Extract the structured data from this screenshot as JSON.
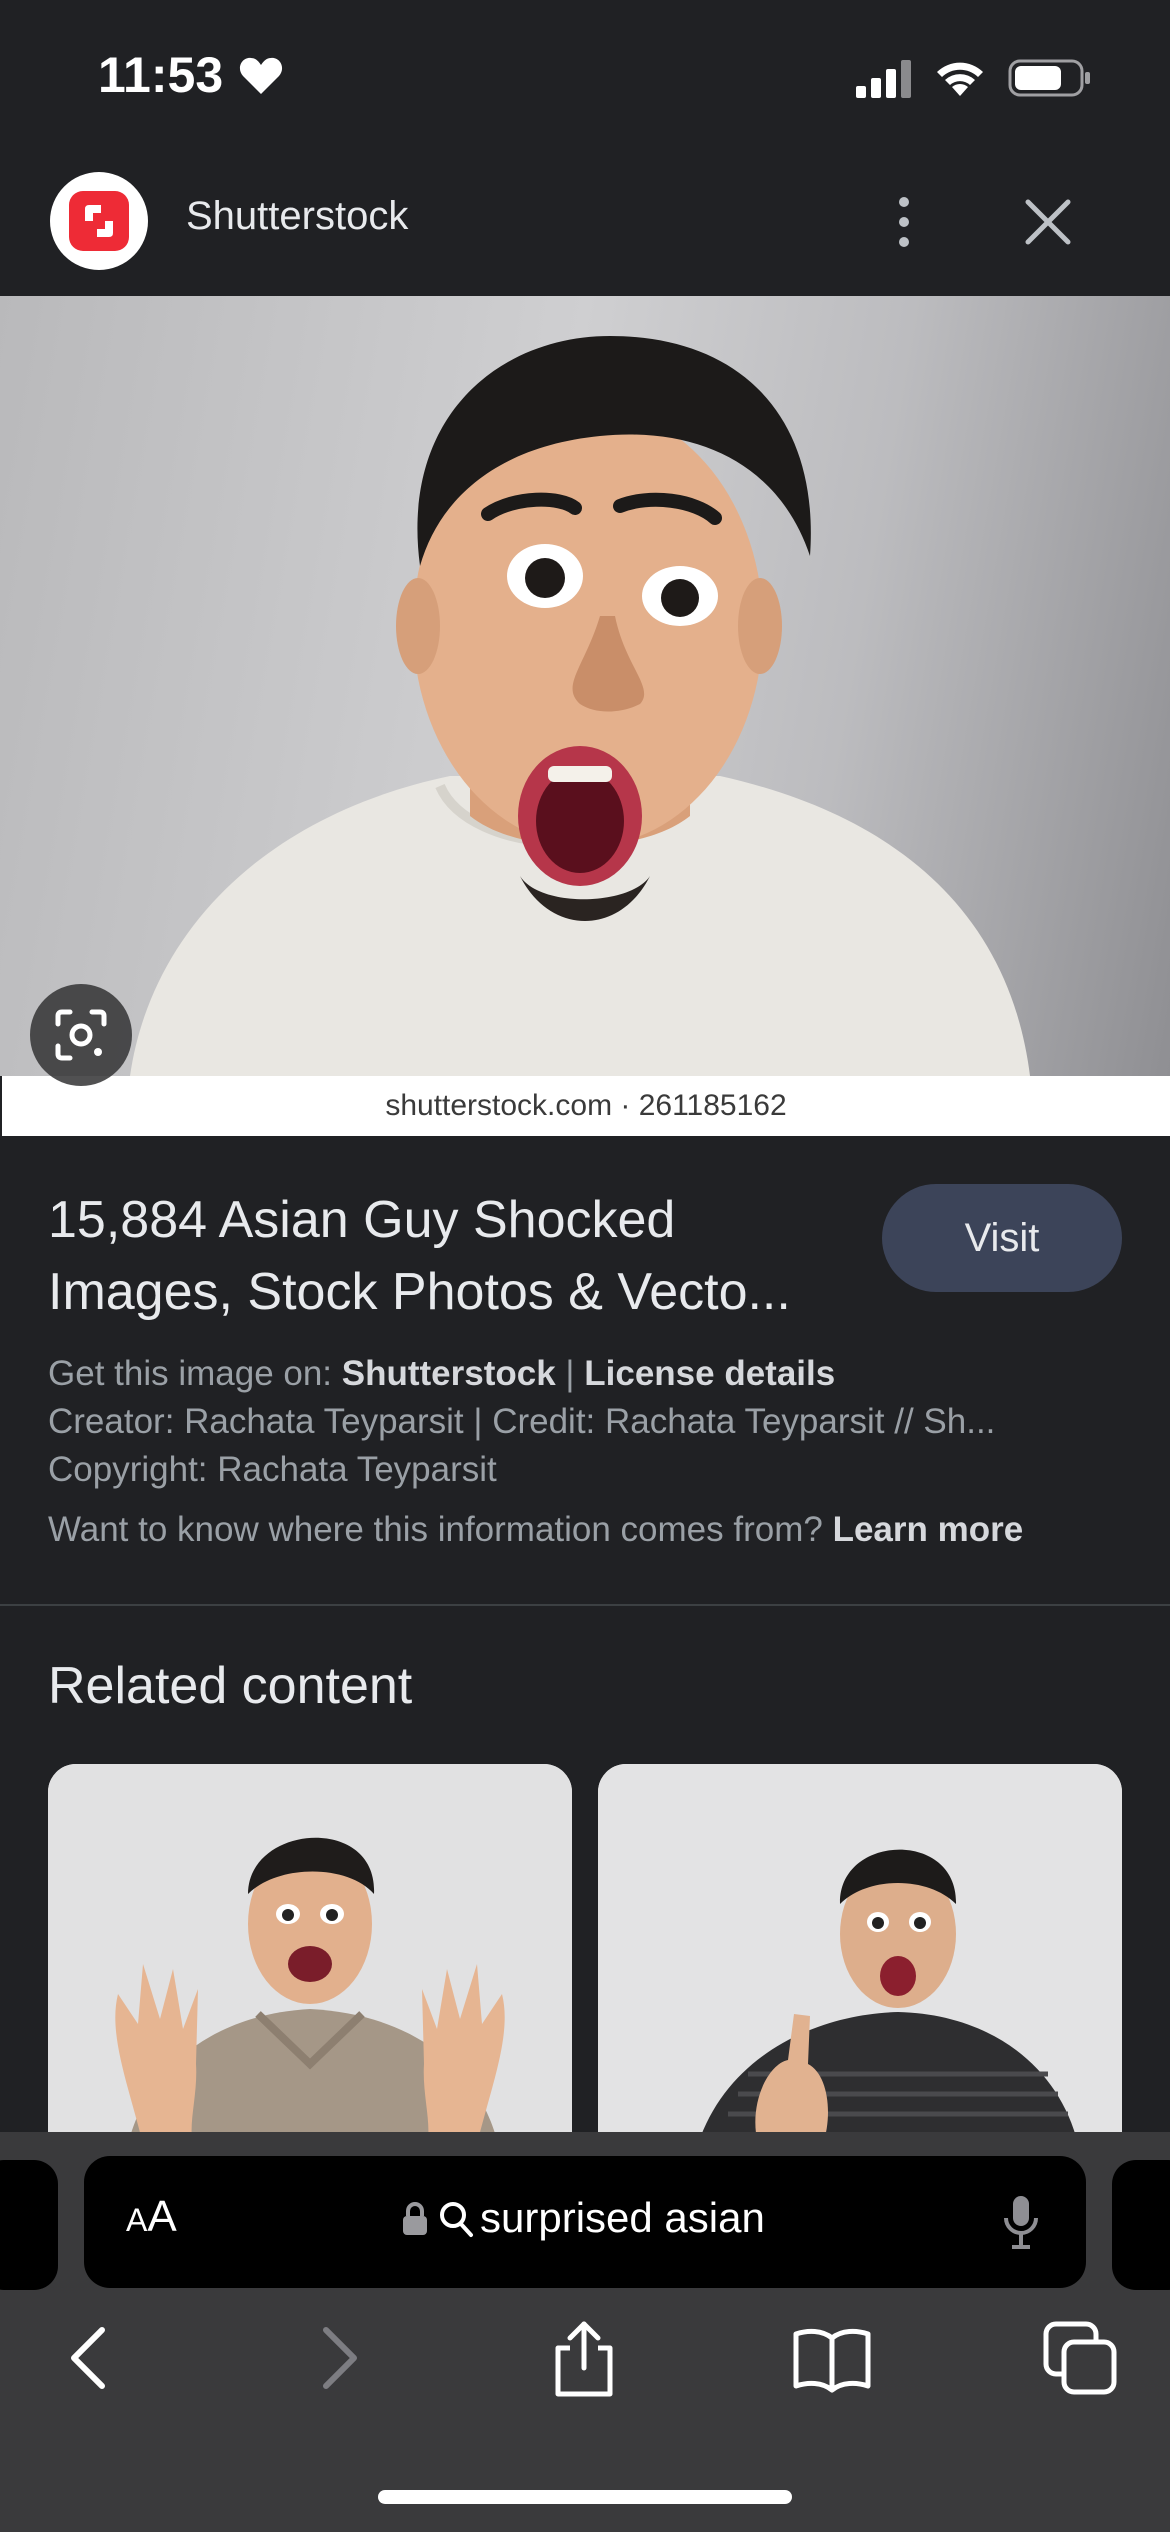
{
  "status_bar": {
    "time": "11:53"
  },
  "header": {
    "site_name": "Shutterstock"
  },
  "image": {
    "watermark_caption": "shutterstock.com · 261185162"
  },
  "info": {
    "title_line1": "15,884 Asian Guy Shocked",
    "title_line2": "Images, Stock Photos & Vecto...",
    "visit_label": "Visit",
    "get_image_prefix": "Get this image on: ",
    "get_image_source": "Shutterstock",
    "separator": " | ",
    "license_link": "License details",
    "creator_line": "Creator: Rachata Teyparsit | Credit: Rachata Teyparsit // Sh...",
    "copyright_line": "Copyright: Rachata Teyparsit",
    "where_info_text": "Want to know where this information comes from? ",
    "learn_more": "Learn more"
  },
  "related": {
    "heading": "Related content"
  },
  "browser": {
    "text_size_small": "A",
    "text_size_large": "A",
    "search_query": "surprised asian"
  },
  "icons": {
    "status": [
      "heart-icon",
      "signal-icon",
      "wifi-icon",
      "battery-icon"
    ],
    "header": [
      "more-vert-icon",
      "close-icon"
    ],
    "toolbar": [
      "back-icon",
      "forward-icon",
      "share-icon",
      "bookmarks-icon",
      "tabs-icon"
    ]
  },
  "colors": {
    "background": "#202124",
    "visit_button": "#3c4459",
    "brand_red": "#ee2b36",
    "browser_bar": "#3a3a3c"
  }
}
